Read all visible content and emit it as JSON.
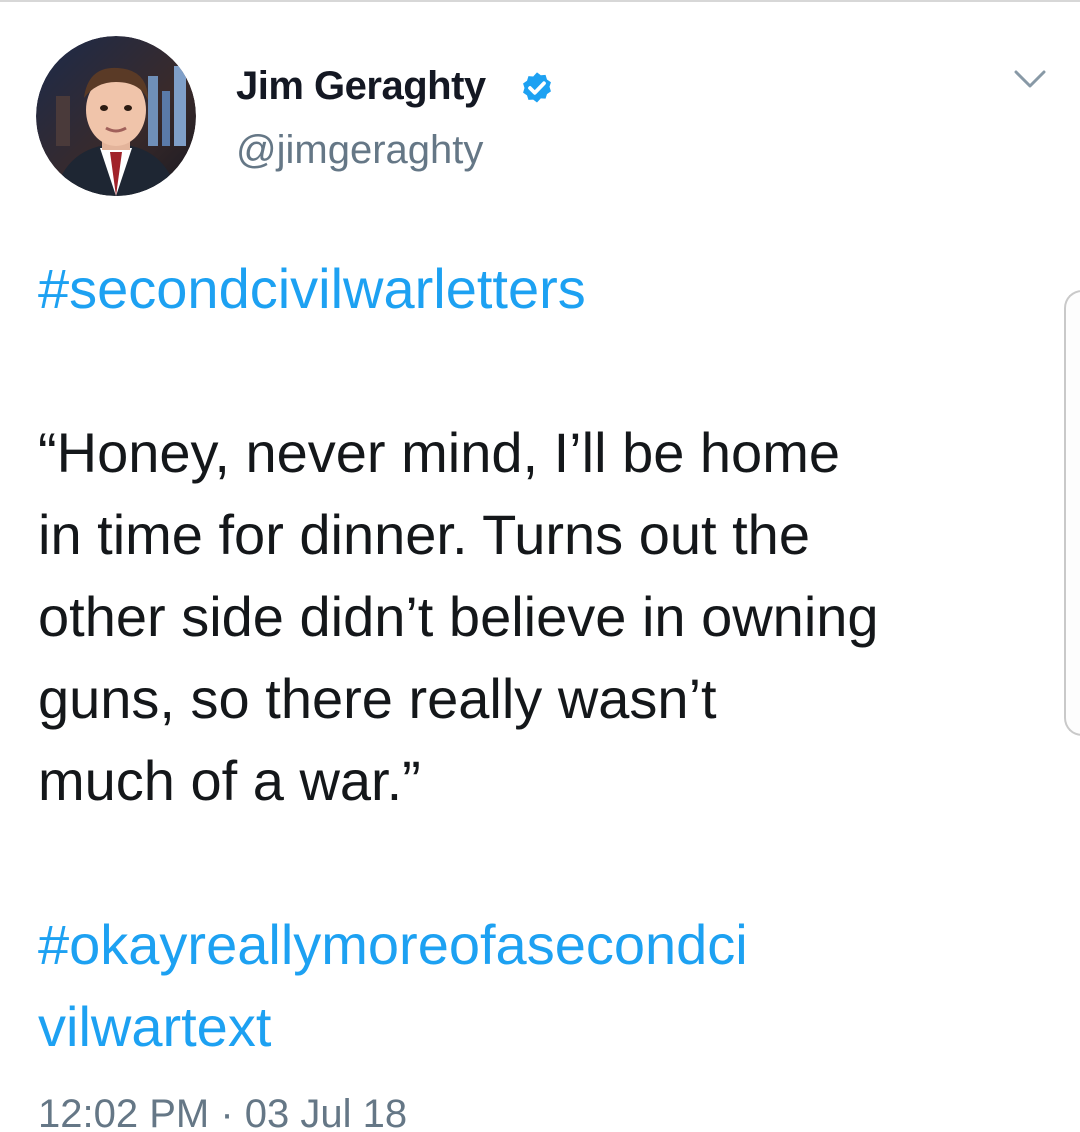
{
  "author": {
    "display_name": "Jim Geraghty",
    "handle": "@jimgeraghty",
    "verified_icon": "verified-badge-icon",
    "avatar_icon": "profile-photo"
  },
  "menu_icon": "chevron-down-icon",
  "tweet": {
    "hashtag_top": "#secondcivilwarletters",
    "body_lines": [
      "“Honey, never mind, I’ll be home",
      "in time for dinner. Turns out the",
      "other side didn’t believe in owning",
      "guns, so there really wasn’t",
      "much of a war.”"
    ],
    "hashtag_bottom_lines": [
      "#okayreallymoreofasecondci",
      "vilwartext"
    ],
    "timestamp": "12:02 PM · 03 Jul 18"
  },
  "colors": {
    "link": "#1da1f2",
    "text": "#14171a",
    "secondary": "#657786",
    "verified": "#1da1f2"
  }
}
